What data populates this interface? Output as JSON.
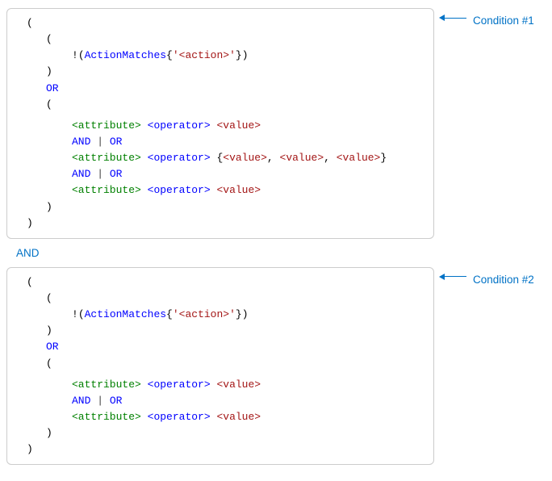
{
  "labels": {
    "cond1": "Condition #1",
    "cond2": "Condition #2"
  },
  "connector": "AND",
  "sym": {
    "openParen": "(",
    "closeParen": ")",
    "bang": "!",
    "openBrace": "{",
    "closeBrace": "}",
    "quote": "'",
    "comma": ",",
    "pipe": " | "
  },
  "kw": {
    "actionMatches": "ActionMatches",
    "or": "OR",
    "and": "AND"
  },
  "ph": {
    "action": "<action>",
    "attribute": "<attribute>",
    "operator": "<operator>",
    "value": "<value>"
  }
}
